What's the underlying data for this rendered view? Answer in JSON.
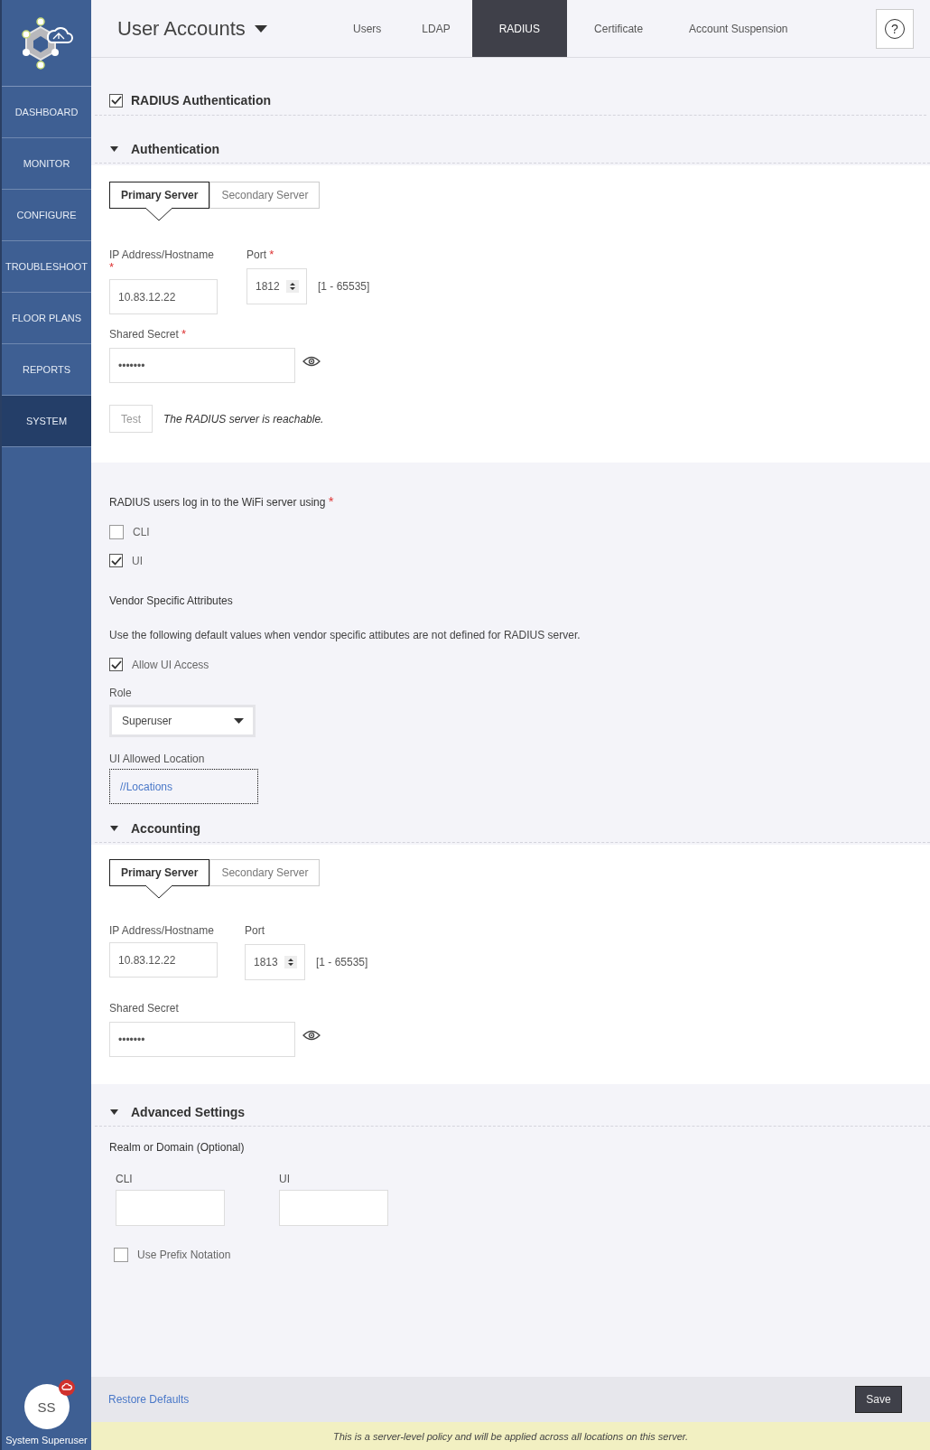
{
  "sidebar": {
    "items": [
      {
        "label": "DASHBOARD",
        "selected": false
      },
      {
        "label": "MONITOR",
        "selected": false
      },
      {
        "label": "CONFIGURE",
        "selected": false
      },
      {
        "label": "TROUBLESHOOT",
        "selected": false
      },
      {
        "label": "FLOOR PLANS",
        "selected": false
      },
      {
        "label": "REPORTS",
        "selected": false
      },
      {
        "label": "SYSTEM",
        "selected": true
      }
    ],
    "user": {
      "initials": "SS",
      "name": "System Superuser"
    }
  },
  "header": {
    "title": "User Accounts",
    "tabs": [
      {
        "label": "Users",
        "selected": false
      },
      {
        "label": "LDAP",
        "selected": false
      },
      {
        "label": "RADIUS",
        "selected": true
      },
      {
        "label": "Certificate",
        "selected": false
      },
      {
        "label": "Account Suspension",
        "selected": false
      }
    ],
    "help": "?"
  },
  "radius_authentication": {
    "label": "RADIUS Authentication",
    "checked": true
  },
  "authentication": {
    "title": "Authentication",
    "expanded": true,
    "server_tabs": [
      {
        "label": "Primary Server",
        "selected": true
      },
      {
        "label": "Secondary Server",
        "selected": false
      }
    ],
    "ip": {
      "label": "IP Address/Hostname",
      "required_mark": "*",
      "value": "10.83.12.22"
    },
    "port": {
      "label": "Port",
      "required_mark": "*",
      "value": "1812",
      "range": "[1 - 65535]"
    },
    "secret": {
      "label": "Shared Secret",
      "required_mark": "*",
      "value": "•••••••"
    },
    "test": {
      "button": "Test",
      "message": "The RADIUS server is reachable."
    }
  },
  "login": {
    "label": "RADIUS users log in to the WiFi server using",
    "required_mark": "*",
    "options": [
      {
        "label": "CLI",
        "checked": false
      },
      {
        "label": "UI",
        "checked": true
      }
    ]
  },
  "vendor": {
    "title": "Vendor Specific Attributes",
    "description": "Use the following default values when vendor specific attibutes are not defined for RADIUS server.",
    "allow_ui_access": {
      "label": "Allow UI Access",
      "checked": true
    },
    "role": {
      "label": "Role",
      "value": "Superuser"
    },
    "location": {
      "label": "UI Allowed Location",
      "value": "//Locations"
    }
  },
  "accounting": {
    "title": "Accounting",
    "expanded": true,
    "server_tabs": [
      {
        "label": "Primary Server",
        "selected": true
      },
      {
        "label": "Secondary Server",
        "selected": false
      }
    ],
    "ip": {
      "label": "IP Address/Hostname",
      "value": "10.83.12.22"
    },
    "port": {
      "label": "Port",
      "value": "1813",
      "range": "[1 - 65535]"
    },
    "secret": {
      "label": "Shared Secret",
      "value": "•••••••"
    }
  },
  "advanced": {
    "title": "Advanced Settings",
    "expanded": true,
    "realm_label": "Realm or Domain (Optional)",
    "cli": {
      "label": "CLI"
    },
    "ui": {
      "label": "UI"
    },
    "prefix": {
      "label": "Use Prefix Notation",
      "checked": false
    }
  },
  "footer": {
    "restore": "Restore Defaults",
    "save": "Save",
    "notice": "This is a server-level policy and will be applied across all locations on this server."
  }
}
